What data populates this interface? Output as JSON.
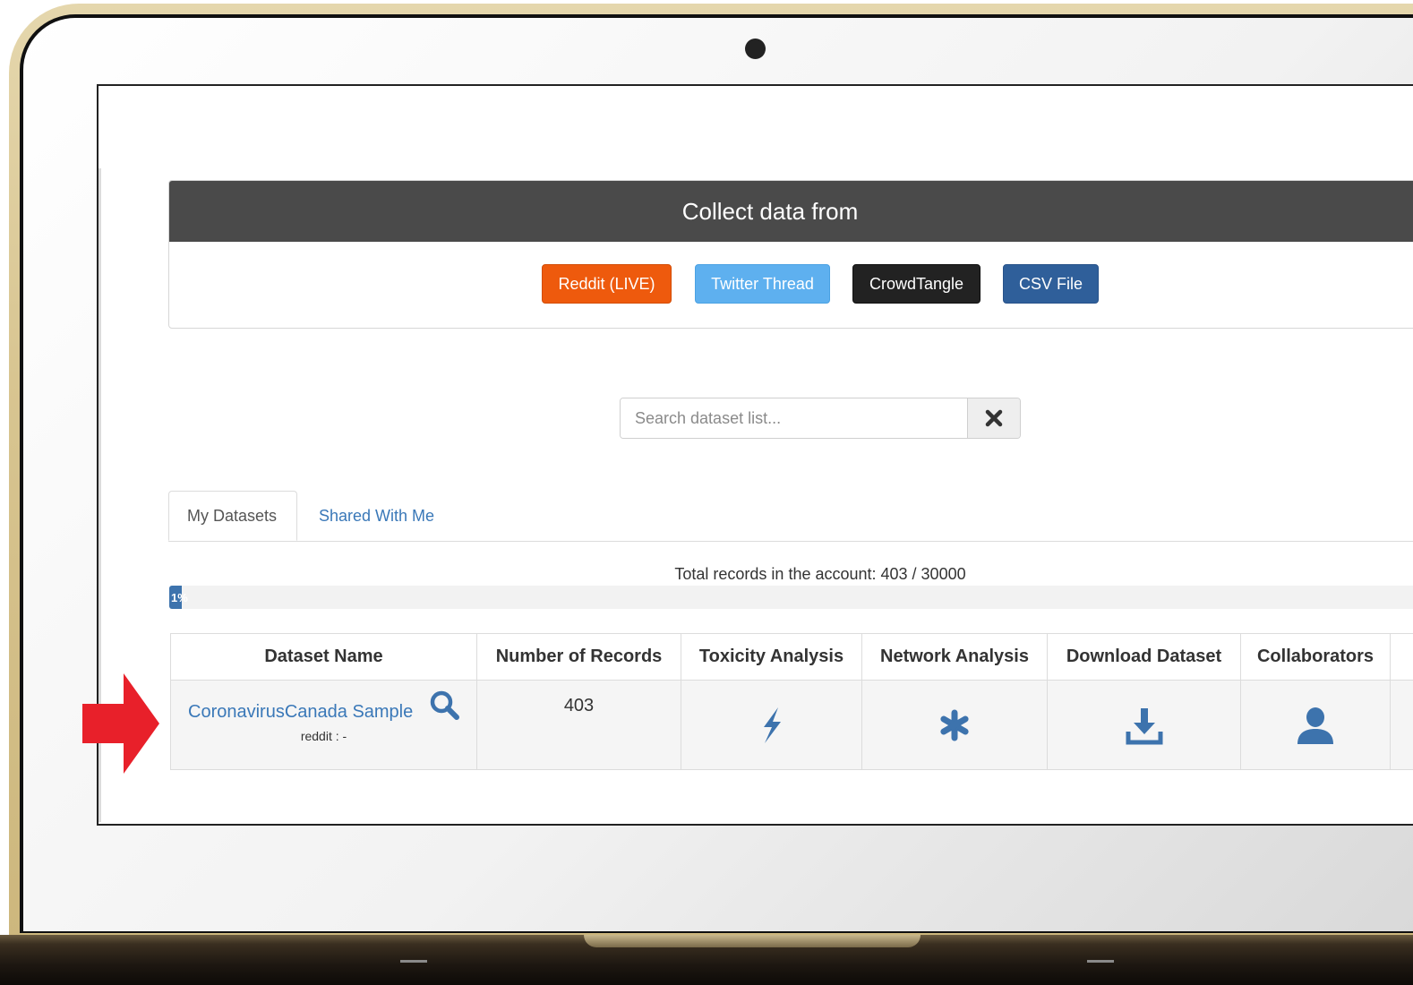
{
  "collect": {
    "title": "Collect data from",
    "buttons": {
      "reddit": "Reddit (LIVE)",
      "twitter": "Twitter Thread",
      "crowdtangle": "CrowdTangle",
      "csv": "CSV File"
    }
  },
  "search": {
    "placeholder": "Search dataset list...",
    "clear_icon": "times-icon"
  },
  "tabs": {
    "mine": "My Datasets",
    "shared": "Shared With Me"
  },
  "account": {
    "total_text": "Total records in the account: 403 / 30000",
    "progress_label": "1%",
    "progress_fraction": 0.01
  },
  "table": {
    "headers": {
      "name": "Dataset Name",
      "records": "Number of Records",
      "toxicity": "Toxicity Analysis",
      "network": "Network Analysis",
      "download": "Download Dataset",
      "collaborators": "Collaborators"
    },
    "rows": [
      {
        "name": "CoronavirusCanada Sample",
        "source": "reddit : -",
        "records": "403",
        "icons": {
          "name": "search-icon",
          "toxicity": "bolt-icon",
          "network": "asterisk-icon",
          "download": "download-icon",
          "collaborators": "user-icon"
        }
      }
    ]
  },
  "colors": {
    "reddit": "#ee5a0d",
    "twitter": "#5eb0ef",
    "crowdtangle": "#222222",
    "csv": "#2f5f9a",
    "link": "#3a78b8",
    "icon": "#3d73ad",
    "header_bar": "#4a4a4a",
    "arrow": "#e8202a"
  }
}
